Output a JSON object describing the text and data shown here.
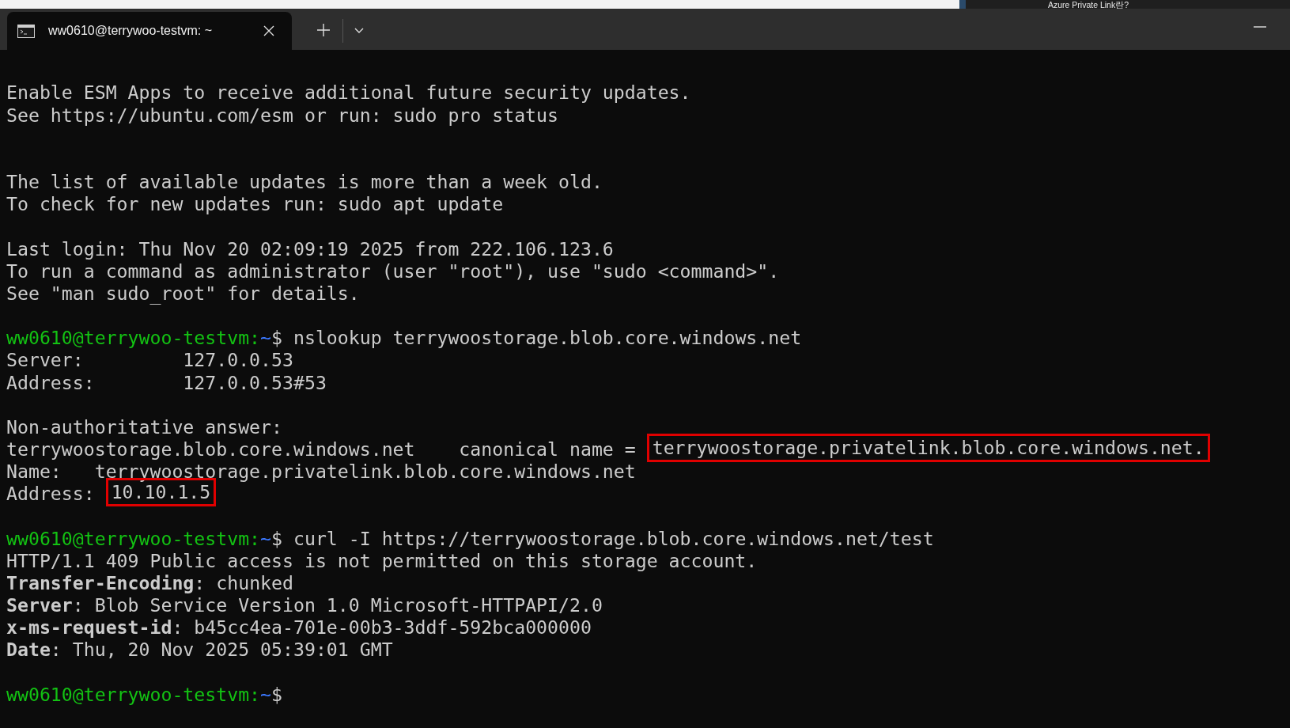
{
  "background_window": {
    "title": "Azure Private Link란?"
  },
  "tab": {
    "title": "ww0610@terrywoo-testvm: ~",
    "selected": true
  },
  "terminal": {
    "blocks": [
      {
        "kind": "motd",
        "lines": [
          {
            "segments": [
              {
                "kind": "text",
                "text": "Enable ESM Apps to receive additional future security updates."
              }
            ]
          },
          {
            "segments": [
              {
                "kind": "text",
                "text": "See https://ubuntu.com/esm or run: sudo pro status"
              }
            ]
          }
        ]
      },
      {
        "kind": "output",
        "lines": [
          {
            "segments": [
              {
                "kind": "text",
                "text": "The list of available updates is more than a week old."
              }
            ]
          },
          {
            "segments": [
              {
                "kind": "text",
                "text": "To check for new updates run: sudo apt update"
              }
            ]
          }
        ]
      },
      {
        "kind": "output",
        "lines": [
          {
            "segments": [
              {
                "kind": "text",
                "text": "Last login: Thu Nov 20 02:09:19 2025 from 222.106.123.6"
              }
            ]
          },
          {
            "segments": [
              {
                "kind": "text",
                "text": "To run a command as administrator (user \"root\"), use \"sudo <command>\"."
              }
            ]
          },
          {
            "segments": [
              {
                "kind": "text",
                "text": "See \"man sudo_root\" for details."
              }
            ]
          }
        ]
      },
      {
        "kind": "output",
        "lines": [
          {
            "segments": [
              {
                "kind": "user",
                "text": "ww0610@terrywoo-testvm:"
              },
              {
                "kind": "path",
                "text": "~"
              },
              {
                "kind": "text",
                "text": "$ nslookup terrywoostorage.blob.core.windows.net"
              }
            ]
          },
          {
            "segments": [
              {
                "kind": "text",
                "text": "Server:         127.0.0.53"
              }
            ]
          },
          {
            "segments": [
              {
                "kind": "text",
                "text": "Address:        127.0.0.53#53"
              }
            ]
          }
        ]
      },
      {
        "kind": "output",
        "lines": [
          {
            "segments": [
              {
                "kind": "text",
                "text": "Non-authoritative answer:"
              }
            ]
          },
          {
            "segments": [
              {
                "kind": "text",
                "text": "terrywoostorage.blob.core.windows.net    canonical name = "
              },
              {
                "kind": "highlight",
                "text": "terrywoostorage.privatelink.blob.core.windows.net."
              }
            ]
          },
          {
            "segments": [
              {
                "kind": "text",
                "text": "Name:   terrywoostorage.privatelink.blob.core.windows.net"
              }
            ]
          },
          {
            "segments": [
              {
                "kind": "text",
                "text": "Address: "
              },
              {
                "kind": "highlight",
                "text": "10.10.1.5"
              }
            ]
          }
        ]
      },
      {
        "kind": "output",
        "lines": [
          {
            "segments": [
              {
                "kind": "user",
                "text": "ww0610@terrywoo-testvm:"
              },
              {
                "kind": "path",
                "text": "~"
              },
              {
                "kind": "text",
                "text": "$ curl -I https://terrywoostorage.blob.core.windows.net/test"
              }
            ]
          },
          {
            "segments": [
              {
                "kind": "text",
                "text": "HTTP/1.1 409 Public access is not permitted on this storage account."
              }
            ]
          },
          {
            "segments": [
              {
                "kind": "header",
                "text": "Transfer-Encoding"
              },
              {
                "kind": "text",
                "text": ": chunked"
              }
            ]
          },
          {
            "segments": [
              {
                "kind": "header",
                "text": "Server"
              },
              {
                "kind": "text",
                "text": ": Blob Service Version 1.0 Microsoft-HTTPAPI/2.0"
              }
            ]
          },
          {
            "segments": [
              {
                "kind": "header",
                "text": "x-ms-request-id"
              },
              {
                "kind": "text",
                "text": ": b45cc4ea-701e-00b3-3ddf-592bca000000"
              }
            ]
          },
          {
            "segments": [
              {
                "kind": "header",
                "text": "Date"
              },
              {
                "kind": "text",
                "text": ": Thu, 20 Nov 2025 05:39:01 GMT"
              }
            ]
          }
        ]
      },
      {
        "kind": "output",
        "lines": [
          {
            "segments": [
              {
                "kind": "user",
                "text": "ww0610@terrywoo-testvm:"
              },
              {
                "kind": "path",
                "text": "~"
              },
              {
                "kind": "text",
                "text": "$"
              }
            ]
          }
        ]
      }
    ]
  }
}
